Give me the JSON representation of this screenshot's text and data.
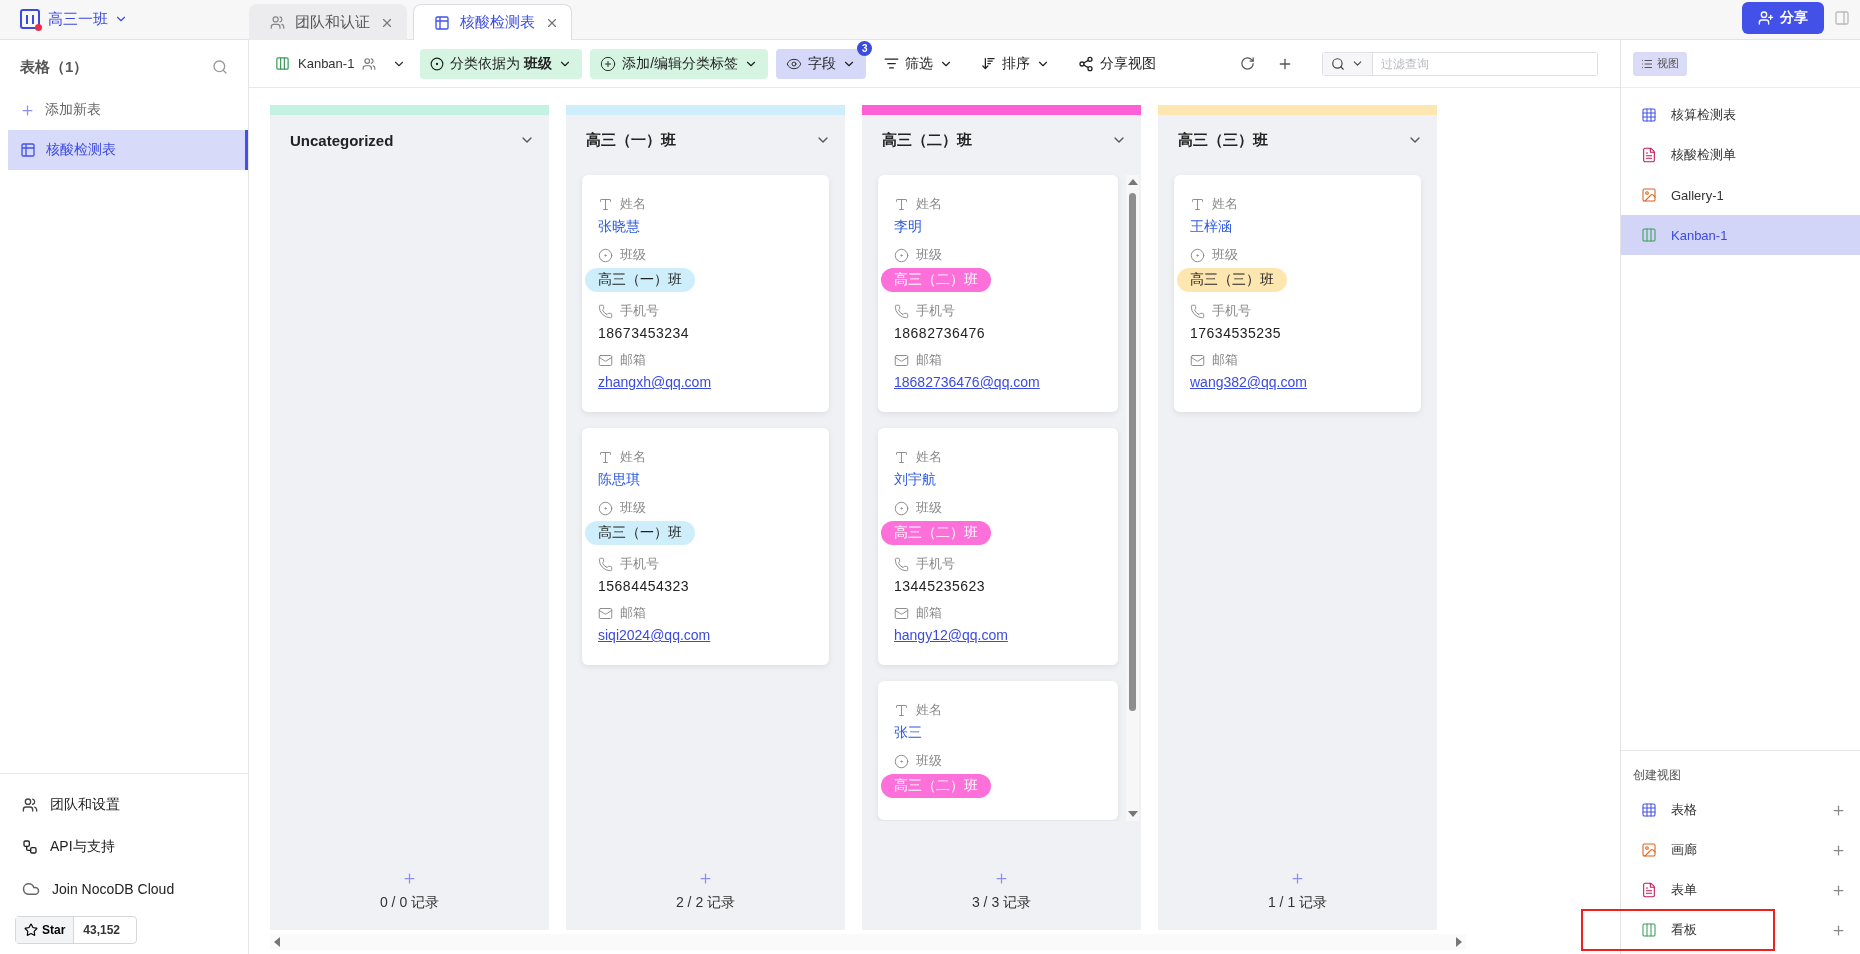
{
  "workspace": {
    "name": "高三一班"
  },
  "tabs": [
    {
      "kind": "team",
      "label": "团队和认证",
      "selected": false
    },
    {
      "kind": "table",
      "label": "核酸检测表",
      "selected": true
    }
  ],
  "share_button": "分享",
  "sidebar": {
    "title": "表格（1）",
    "add_table": "添加新表",
    "tables": [
      {
        "label": "核酸检测表",
        "selected": true
      }
    ],
    "footer_links": [
      {
        "kind": "team",
        "label": "团队和设置"
      },
      {
        "kind": "api",
        "label": "API与支持"
      },
      {
        "kind": "cloud",
        "label": "Join NocoDB Cloud"
      }
    ],
    "star": {
      "label": "Star",
      "count": "43,152"
    }
  },
  "toolbar": {
    "view_name": "Kanban-1",
    "group_by": "分类依据为 **班级**",
    "edit_labels": "添加/编辑分类标签",
    "fields": {
      "label": "字段",
      "badge": "3"
    },
    "filter": "筛选",
    "sort": "排序",
    "share_view": "分享视图",
    "search": {
      "placeholder": "过滤查询"
    }
  },
  "board": {
    "columns": [
      {
        "title": "Uncategorized",
        "color": "#c3f1e2",
        "count": "0 / 0 记录"
      },
      {
        "title": "高三（一）班",
        "color": "#cfeefb",
        "count": "2 / 2 记录",
        "cards": [
          {
            "fields": [
              {
                "kind": "text",
                "label": "姓名",
                "value": "张晓慧"
              },
              {
                "kind": "select",
                "label": "班级",
                "value": "高三（一）班",
                "color": "#cfeefb"
              },
              {
                "kind": "phone",
                "label": "手机号",
                "value": "18673453234"
              },
              {
                "kind": "email",
                "label": "邮箱",
                "value": "zhangxh@qq.com"
              }
            ]
          },
          {
            "fields": [
              {
                "kind": "text",
                "label": "姓名",
                "value": "陈思琪"
              },
              {
                "kind": "select",
                "label": "班级",
                "value": "高三（一）班",
                "color": "#cfeefb"
              },
              {
                "kind": "phone",
                "label": "手机号",
                "value": "15684454323"
              },
              {
                "kind": "email",
                "label": "邮箱",
                "value": "siqi2024@qq.com"
              }
            ]
          }
        ]
      },
      {
        "title": "高三（二）班",
        "color": "#fc5fd6",
        "count": "3 / 3 记录",
        "cards": [
          {
            "fields": [
              {
                "kind": "text",
                "label": "姓名",
                "value": "李明"
              },
              {
                "kind": "select",
                "label": "班级",
                "value": "高三（二）班",
                "color": "#fd6fd9"
              },
              {
                "kind": "phone",
                "label": "手机号",
                "value": "18682736476"
              },
              {
                "kind": "email",
                "label": "邮箱",
                "value": "18682736476@qq.com"
              }
            ]
          },
          {
            "fields": [
              {
                "kind": "text",
                "label": "姓名",
                "value": "刘宇航"
              },
              {
                "kind": "select",
                "label": "班级",
                "value": "高三（二）班",
                "color": "#fd6fd9"
              },
              {
                "kind": "phone",
                "label": "手机号",
                "value": "13445235623"
              },
              {
                "kind": "email",
                "label": "邮箱",
                "value": "hangy12@qq.com"
              }
            ]
          },
          {
            "fields": [
              {
                "kind": "text",
                "label": "姓名",
                "value": "张三"
              },
              {
                "kind": "select",
                "label": "班级",
                "value": "高三（二）班",
                "color": "#fd6fd9"
              }
            ]
          }
        ]
      },
      {
        "title": "高三（三）班",
        "color": "#fde6b0",
        "count": "1 / 1 记录",
        "cards": [
          {
            "fields": [
              {
                "kind": "text",
                "label": "姓名",
                "value": "王梓涵"
              },
              {
                "kind": "select",
                "label": "班级",
                "value": "高三（三）班",
                "color": "#fde6b0"
              },
              {
                "kind": "phone",
                "label": "手机号",
                "value": "17634535235"
              },
              {
                "kind": "email",
                "label": "邮箱",
                "value": "wang382@qq.com"
              }
            ]
          }
        ]
      }
    ]
  },
  "views_panel": {
    "toggle": "视图",
    "views": [
      {
        "kind": "grid",
        "label": "核算检测表",
        "selected": false
      },
      {
        "kind": "form",
        "label": "核酸检测单",
        "selected": false
      },
      {
        "kind": "gallery",
        "label": "Gallery-1",
        "selected": false
      },
      {
        "kind": "kanban",
        "label": "Kanban-1",
        "selected": true
      }
    ],
    "create_title": "创建视图",
    "create": [
      {
        "kind": "grid",
        "label": "表格",
        "highlighted": false
      },
      {
        "kind": "gallery",
        "label": "画廊",
        "highlighted": false
      },
      {
        "kind": "form",
        "label": "表单",
        "highlighted": false
      },
      {
        "kind": "kanban",
        "label": "看板",
        "highlighted": true
      }
    ]
  }
}
